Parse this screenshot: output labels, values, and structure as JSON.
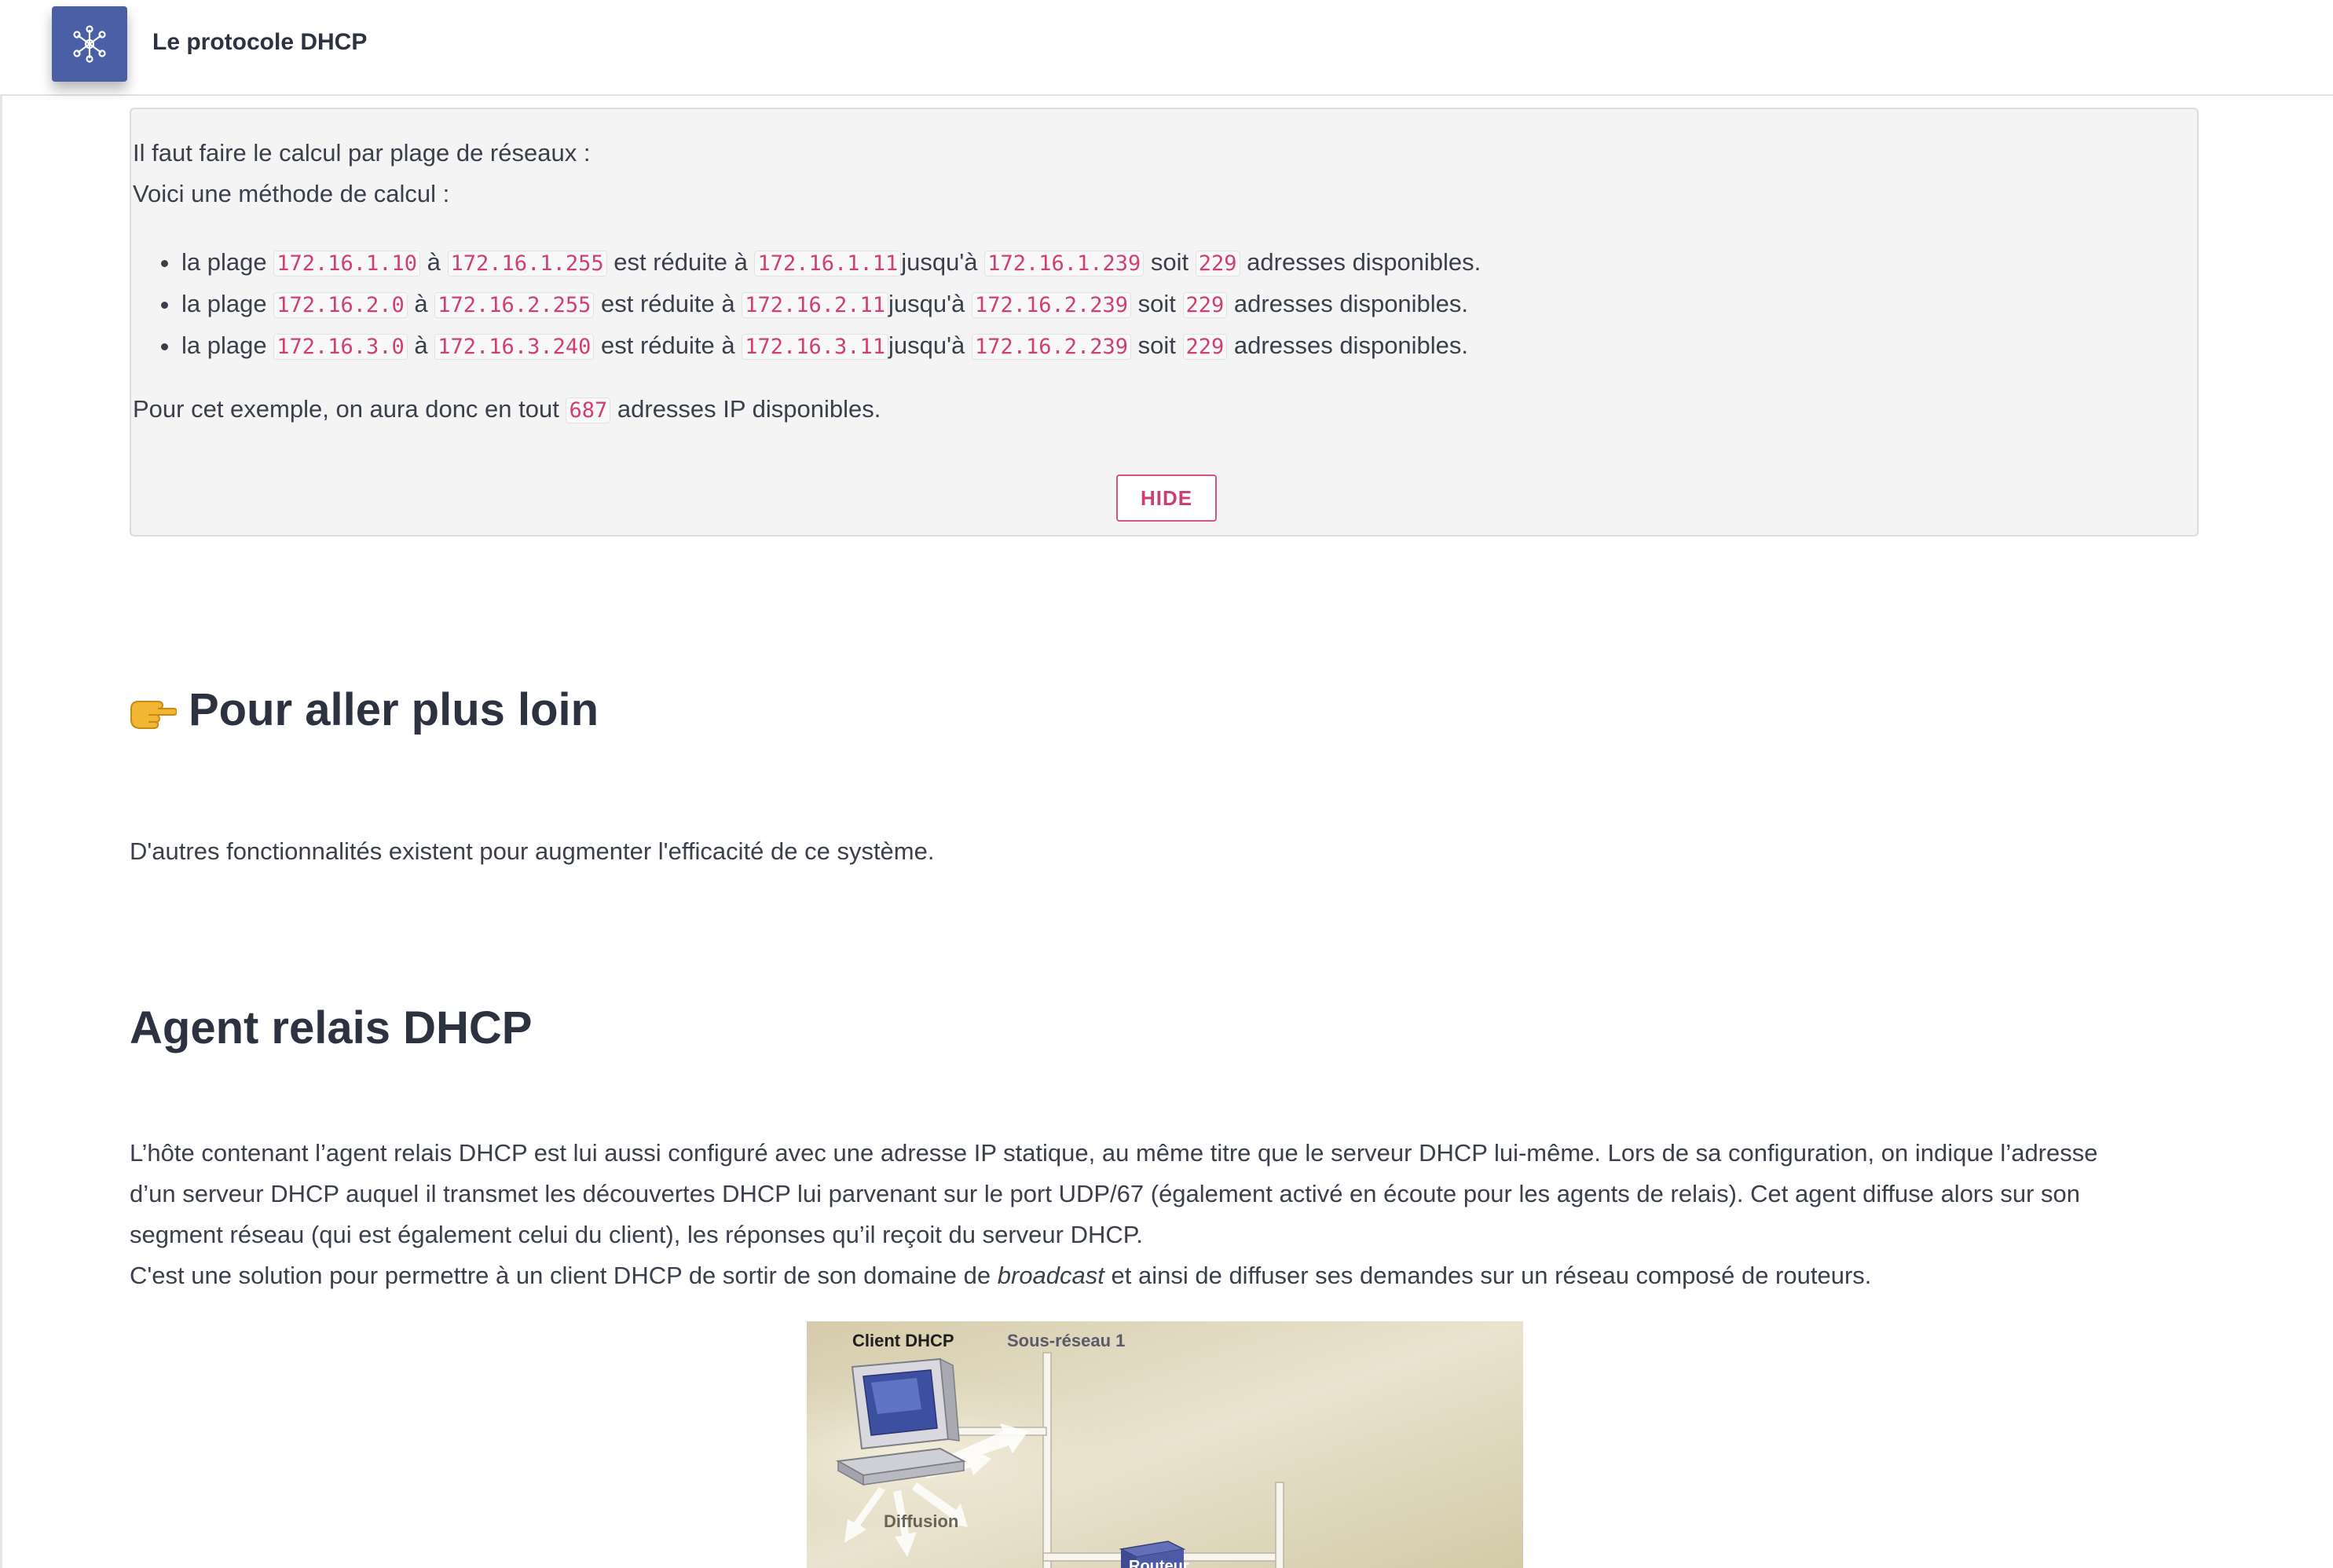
{
  "app": {
    "title": "Le protocole DHCP",
    "logo_icon": "network-nodes-icon",
    "accent_color": "#4a5fa5"
  },
  "solution_panel": {
    "intro": "Il faut faire le calcul par plage de réseaux :",
    "method": "Voici une méthode de calcul :",
    "ranges": [
      {
        "prefix": "la plage",
        "start": "172.16.1.10",
        "a": "à",
        "end": "172.16.1.255",
        "reduced": "est réduite à",
        "from": "172.16.1.11",
        "until": "jusqu'à",
        "to": "172.16.1.239",
        "soit": "soit",
        "count": "229",
        "suffix": "adresses disponibles."
      },
      {
        "prefix": "la plage",
        "start": "172.16.2.0",
        "a": "à",
        "end": "172.16.2.255",
        "reduced": "est réduite à",
        "from": "172.16.2.11",
        "until": "jusqu'à",
        "to": "172.16.2.239",
        "soit": "soit",
        "count": "229",
        "suffix": "adresses disponibles."
      },
      {
        "prefix": "la plage",
        "start": "172.16.3.0",
        "a": "à",
        "end": "172.16.3.240",
        "reduced": "est réduite à",
        "from": "172.16.3.11",
        "until": "jusqu'à",
        "to": "172.16.2.239",
        "soit": "soit",
        "count": "229",
        "suffix": "adresses disponibles."
      }
    ],
    "total_before": "Pour cet exemple, on aura donc en tout",
    "total": "687",
    "total_after": "adresses IP disponibles.",
    "hide_label": "HIDE"
  },
  "further": {
    "title": "Pour aller plus loin",
    "icon": "pointing-hand-icon",
    "text": "D'autres fonctionnalités existent pour augmenter l'efficacité de ce système."
  },
  "relay": {
    "title": "Agent relais DHCP",
    "line1": "L’hôte contenant l’agent relais DHCP est lui aussi configuré avec une adresse IP statique, au même titre que le serveur DHCP lui-même. Lors de sa configuration, on indique l’adresse",
    "line2": "d’un serveur DHCP auquel il transmet les découvertes DHCP lui parvenant sur le port UDP/67 (également activé en écoute pour les agents de relais). Cet agent diffuse alors sur son",
    "line3": "segment réseau (qui est également celui du client), les réponses qu’il reçoit du serveur DHCP.",
    "line4_before": "C'est une solution pour permettre à un client DHCP de sortir de son domaine de",
    "line4_em": "broadcast",
    "line4_after": "et ainsi de diffuser ses demandes sur un réseau composé de routeurs."
  },
  "diagram": {
    "client_label": "Client DHCP",
    "subnet_label": "Sous-réseau 1",
    "broadcast_label": "Diffusion",
    "router_label": "Routeur"
  }
}
